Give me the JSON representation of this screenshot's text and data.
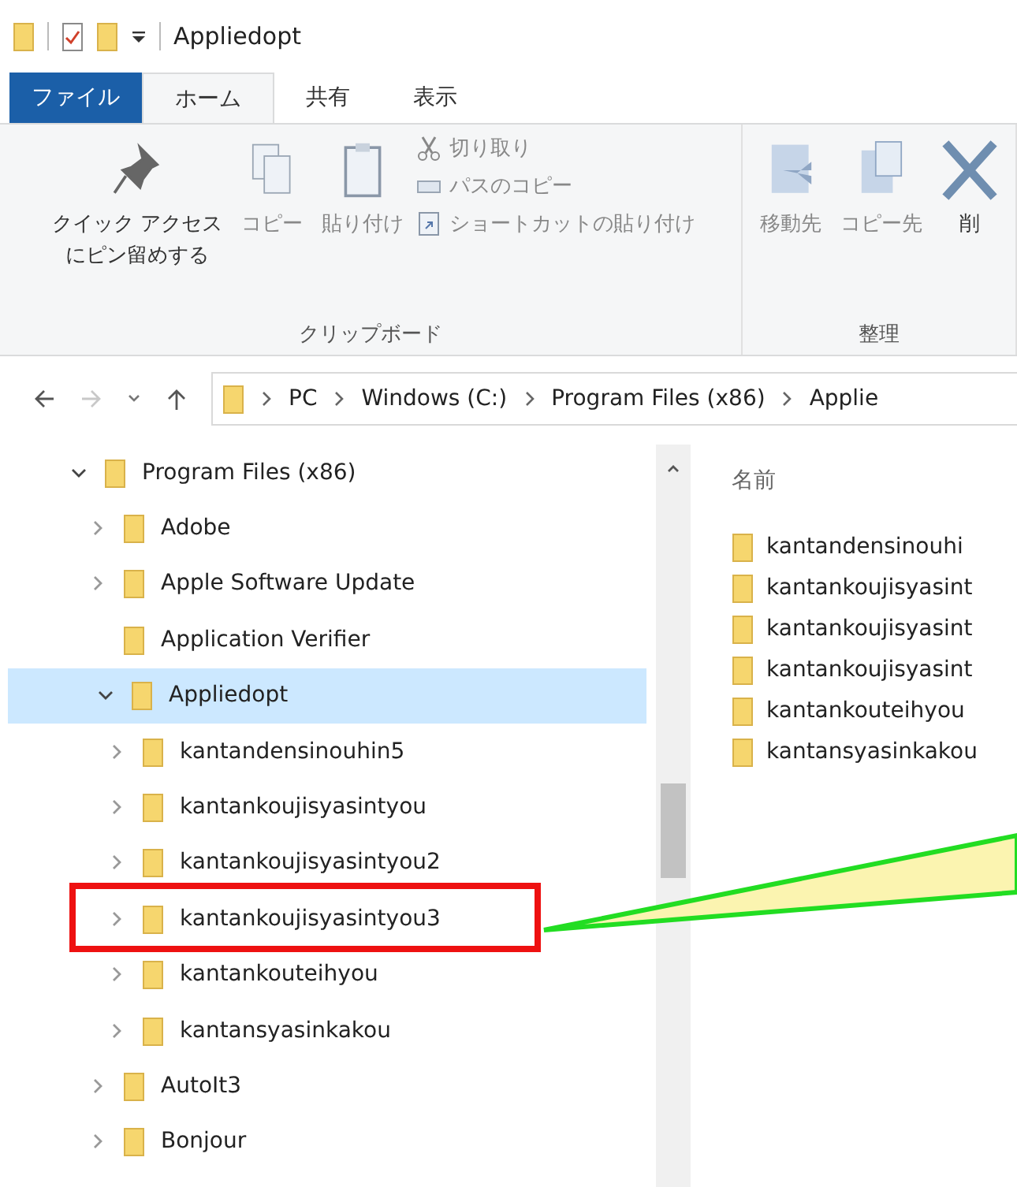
{
  "window": {
    "title": "Appliedopt"
  },
  "tabs": [
    {
      "label": "ファイル",
      "kind": "file",
      "selected": false
    },
    {
      "label": "ホーム",
      "kind": "tab",
      "selected": true
    },
    {
      "label": "共有",
      "kind": "tab",
      "selected": false
    },
    {
      "label": "表示",
      "kind": "tab",
      "selected": false
    }
  ],
  "ribbon": {
    "groups": [
      {
        "label": "クリップボード",
        "buttons": [
          {
            "label": [
              "クイック アクセス",
              "にピン留めする"
            ],
            "kind": "large",
            "disabled": false
          },
          {
            "label": "コピー",
            "kind": "large",
            "disabled": true
          },
          {
            "label": "貼り付け",
            "kind": "large",
            "disabled": true
          },
          {
            "label": "切り取り",
            "kind": "small",
            "disabled": true
          },
          {
            "label": "パスのコピー",
            "kind": "small",
            "disabled": true
          },
          {
            "label": "ショートカットの貼り付け",
            "kind": "small",
            "disabled": true
          }
        ]
      },
      {
        "label": "整理",
        "buttons": [
          {
            "label": "移動先",
            "kind": "large",
            "disabled": true
          },
          {
            "label": "コピー先",
            "kind": "large",
            "disabled": true
          },
          {
            "label": "削",
            "kind": "large",
            "disabled": false
          }
        ]
      }
    ]
  },
  "address": {
    "crumbs": [
      "PC",
      "Windows (C:)",
      "Program Files (x86)",
      "Applie"
    ]
  },
  "nav_tree": [
    {
      "label": "Program Files (x86)",
      "expandable": true,
      "expanded": true,
      "selected": false,
      "annotated": false,
      "children": [
        {
          "label": "Adobe",
          "expandable": true,
          "expanded": false,
          "selected": false,
          "annotated": false
        },
        {
          "label": "Apple Software Update",
          "expandable": true,
          "expanded": false,
          "selected": false,
          "annotated": false
        },
        {
          "label": "Application Verifier",
          "expandable": false,
          "expanded": false,
          "selected": false,
          "annotated": false
        },
        {
          "label": "Appliedopt",
          "expandable": true,
          "expanded": true,
          "selected": true,
          "annotated": false,
          "children": [
            {
              "label": "kantandensinouhin5",
              "expandable": true,
              "expanded": false,
              "selected": false,
              "annotated": false
            },
            {
              "label": "kantankoujisyasintyou",
              "expandable": true,
              "expanded": false,
              "selected": false,
              "annotated": false
            },
            {
              "label": "kantankoujisyasintyou2",
              "expandable": true,
              "expanded": false,
              "selected": false,
              "annotated": false
            },
            {
              "label": "kantankoujisyasintyou3",
              "expandable": true,
              "expanded": false,
              "selected": false,
              "annotated": true
            },
            {
              "label": "kantankouteihyou",
              "expandable": true,
              "expanded": false,
              "selected": false,
              "annotated": false
            },
            {
              "label": "kantansyasinkakou",
              "expandable": true,
              "expanded": false,
              "selected": false,
              "annotated": false
            }
          ]
        },
        {
          "label": "AutoIt3",
          "expandable": true,
          "expanded": false,
          "selected": false,
          "annotated": false
        },
        {
          "label": "Bonjour",
          "expandable": true,
          "expanded": false,
          "selected": false,
          "annotated": false
        }
      ]
    }
  ],
  "file_list": {
    "column": "名前",
    "items": [
      "kantandensinouhi",
      "kantankoujisyasint",
      "kantankoujisyasint",
      "kantankoujisyasint",
      "kantankouteihyou",
      "kantansyasinkakou"
    ]
  }
}
